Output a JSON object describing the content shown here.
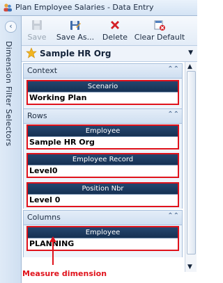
{
  "window": {
    "title": "Plan Employee Salaries - Data Entry"
  },
  "sidebar": {
    "label": "Dimension Filter Selectors",
    "collapse_icon": "chevron-left-icon"
  },
  "toolbar": {
    "save_label": "Save",
    "save_as_label": "Save As...",
    "delete_label": "Delete",
    "clear_default_label": "Clear Default"
  },
  "org": {
    "name": "Sample HR Org"
  },
  "context": {
    "title": "Context",
    "items": [
      {
        "header": "Scenario",
        "value": "Working Plan"
      }
    ]
  },
  "rows": {
    "title": "Rows",
    "items": [
      {
        "header": "Employee",
        "value": "Sample HR Org"
      },
      {
        "header": "Employee Record",
        "value": "Level0"
      },
      {
        "header": "Position Nbr",
        "value": "Level 0"
      }
    ]
  },
  "columns": {
    "title": "Columns",
    "items": [
      {
        "header": "Employee",
        "value": "PLANNING"
      }
    ]
  },
  "annotation": {
    "text": "Measure dimension"
  },
  "colors": {
    "highlight": "#e0121b",
    "header_bg": "#1f3d63",
    "panel_bg": "#eef3fa"
  }
}
